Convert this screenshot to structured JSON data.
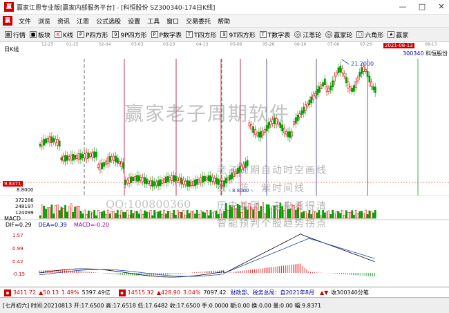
{
  "window": {
    "title": "赢家江恩专业版[赢家内部服务平台] - [科恒股份  SZ300340-174日K线]",
    "logo": "赢",
    "controls": [
      "—",
      "□",
      "✕"
    ]
  },
  "menu": [
    "文件",
    "浏览",
    "资讯",
    "江恩",
    "公式选股",
    "设置",
    "工具",
    "窗口",
    "交易委托",
    "帮助"
  ],
  "toolbar": [
    {
      "label": "行情",
      "icon": "grid-icon"
    },
    {
      "label": "板块",
      "icon": "block-icon"
    },
    {
      "label": "K线",
      "icon": "kline-icon"
    },
    {
      "label": "P四方形",
      "icon": "square-icon"
    },
    {
      "label": "9P四方形",
      "icon": "square-icon"
    },
    {
      "label": "P数字表",
      "icon": "table-icon"
    },
    {
      "label": "T四方形",
      "icon": "square-icon"
    },
    {
      "label": "9T四方形",
      "icon": "square-icon"
    },
    {
      "label": "T数字表",
      "icon": "table-icon"
    },
    {
      "label": "江恩轮",
      "icon": "wheel-icon"
    },
    {
      "label": "赢家轮",
      "icon": "wheel-icon"
    },
    {
      "label": "六角形",
      "icon": "hexagon-icon"
    },
    {
      "label": "赢家",
      "icon": "star-icon"
    }
  ],
  "chart": {
    "period_label": "日K线",
    "date_ticks": [
      "12-25",
      "01-15",
      "02-04",
      "03-03",
      "03-23",
      "04-13",
      "05-06",
      "05-26",
      "06-16",
      "07-06",
      "07-26",
      "08-13"
    ],
    "current_date": "2021-08-13",
    "stock_code": "300340",
    "stock_name": "科恒股份",
    "high_label": "21.2000",
    "low_label": "8.8000",
    "low_marker": "8.8000",
    "price_box": "9.8371",
    "volume_labels": [
      "372286",
      "248197",
      "124099"
    ],
    "watermark_title": "赢家老子周期软件",
    "watermark_lines": [
      "老子周期自动时空画线",
      "红、蓝、紫时间线",
      "历史基因，未来看得清",
      "智能预判个股趋势拐点"
    ],
    "watermark_qq": "QQ:100800360",
    "colors": {
      "up": "#e00000",
      "down": "#00a000",
      "grid": "#cccccc",
      "cycle_red": "#b00030",
      "cycle_green": "#00a000"
    }
  },
  "macd": {
    "tag": "MACD",
    "dif_label": "DIF=0.29",
    "dea_label": "DEA=0.39",
    "macd_label": "MACD=-0.20",
    "axis": [
      "1.57",
      "0.99",
      "0.42",
      "-0.15"
    ]
  },
  "status": {
    "sh_index": "3411.72",
    "sh_change": "▲50.13",
    "sh_pct": "1.49%",
    "sh_amount": "5397.49亿",
    "sz_index": "14515.32",
    "sz_change": "▲428.90",
    "sz_pct": "3.04%",
    "sz_amount": "7097.42",
    "news": "财政部、税务总局：自2021年8月",
    "ticker": "收300340分笔"
  },
  "bottom": {
    "text": "[七月初六] 时间:20210813 开:17.6500 高:17.6518 低:17.6482 收:17.6500 手:0.0000 额:0.00 换:0.00 量:0.00 幅:9.8371"
  }
}
